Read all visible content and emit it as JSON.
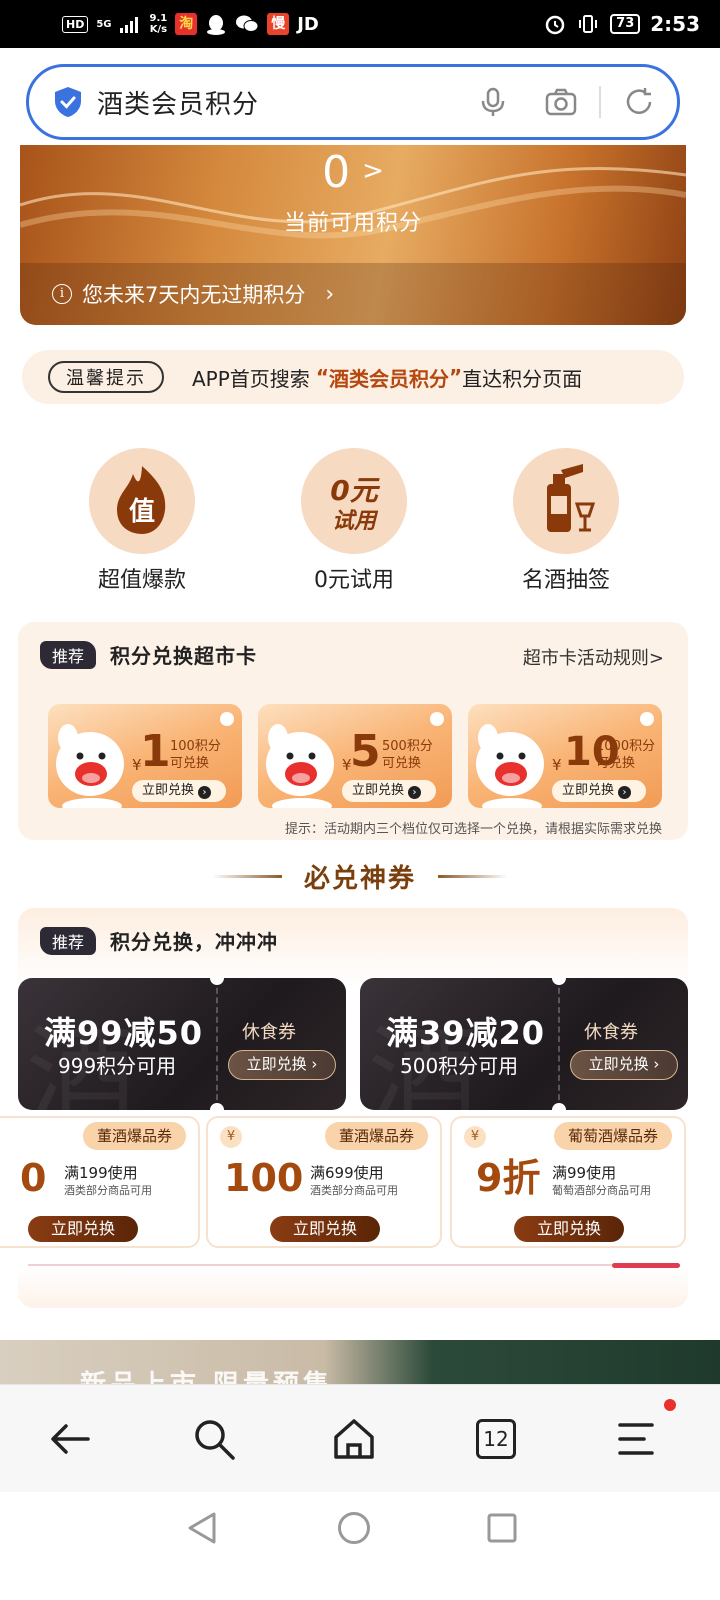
{
  "status_bar": {
    "hd": "HD",
    "network": "5G",
    "speed_value": "9.1",
    "speed_unit": "K/s",
    "app_badge": "JD",
    "slow_icon_text": "慢",
    "battery": "73",
    "time": "2:53"
  },
  "search": {
    "query": "酒类会员积分"
  },
  "points": {
    "value": "0",
    "label": "当前可用积分",
    "expiry_text": "您未来7天内无过期积分"
  },
  "tip": {
    "badge": "温馨提示",
    "text_before": "APP首页搜索",
    "open_quote": "“",
    "highlight": "酒类会员积分",
    "close_quote": "”",
    "text_after": "直达积分页面"
  },
  "categories": [
    {
      "label": "超值爆款",
      "icon_text": "值"
    },
    {
      "label": "0元试用",
      "icon_line1": "0元",
      "icon_line2": "试用"
    },
    {
      "label": "名酒抽签"
    }
  ],
  "supermarket": {
    "badge": "推荐",
    "title": "积分兑换超市卡",
    "rules_link": "超市卡活动规则>",
    "vouchers": [
      {
        "currency": "¥",
        "amount": "1",
        "points": "100积分",
        "note": "可兑换",
        "button": "立即兑换"
      },
      {
        "currency": "¥",
        "amount": "5",
        "points": "500积分",
        "note": "可兑换",
        "button": "立即兑换"
      },
      {
        "currency": "¥",
        "amount": "10",
        "points": "1000积分",
        "note": "可兑换",
        "button": "立即兑换"
      }
    ],
    "note": "提示：活动期内三个档位仅可选择一个兑换，请根据实际需求兑换"
  },
  "must_section": {
    "title": "必兑神券"
  },
  "coupons": {
    "badge": "推荐",
    "title": "积分兑换，冲冲冲",
    "big": [
      {
        "title": "满99减50",
        "points": "999积分可用",
        "kind": "休食券",
        "button": "立即兑换 ›"
      },
      {
        "title": "满39减20",
        "points": "500积分可用",
        "kind": "休食券",
        "button": "立即兑换 ›"
      }
    ],
    "small": [
      {
        "tag": "董酒爆品券",
        "value": "0",
        "condition": "满199使用",
        "scope": "酒类部分商品可用",
        "button": "立即兑换"
      },
      {
        "tag": "董酒爆品券",
        "currency": "¥",
        "value": "100",
        "condition": "满699使用",
        "scope": "酒类部分商品可用",
        "button": "立即兑换"
      },
      {
        "tag": "葡萄酒爆品券",
        "currency": "¥",
        "value": "9折",
        "condition": "满99使用",
        "scope": "葡萄酒部分商品可用",
        "button": "立即兑换"
      }
    ]
  },
  "promo": {
    "text": "新品上市 限量预售"
  },
  "browser_nav": {
    "tab_count": "12"
  },
  "colors": {
    "accent_blue": "#3a72e0",
    "brand_brown": "#a54a0f",
    "tip_highlight": "#b5470f",
    "notification_red": "#e8302c"
  }
}
